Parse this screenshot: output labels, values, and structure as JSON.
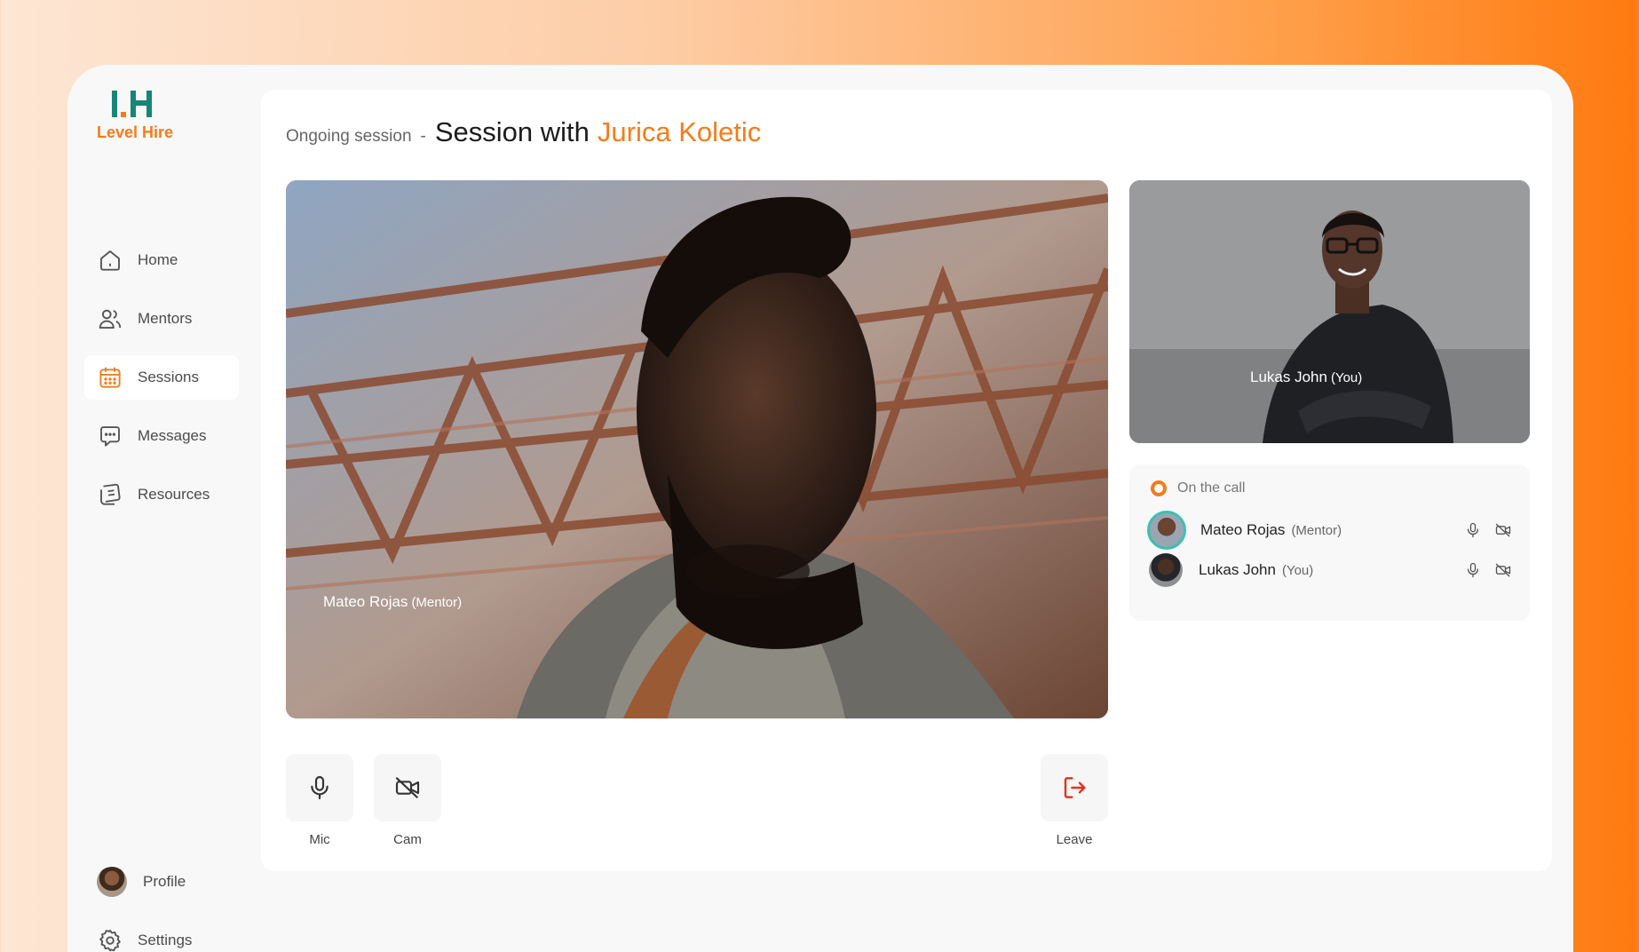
{
  "brand": {
    "name": "Level Hire",
    "accent": "#f47c1b",
    "mark_color": "#178676"
  },
  "sidebar": {
    "items": [
      {
        "label": "Home",
        "icon": "home-icon"
      },
      {
        "label": "Mentors",
        "icon": "users-icon"
      },
      {
        "label": "Sessions",
        "icon": "calendar-icon",
        "active": true
      },
      {
        "label": "Messages",
        "icon": "chat-icon"
      },
      {
        "label": "Resources",
        "icon": "book-icon"
      }
    ],
    "profile_label": "Profile",
    "settings_label": "Settings"
  },
  "header": {
    "prefix": "Ongoing session",
    "separator": "-",
    "title": "Session with",
    "partner_name": "Jurica Koletic"
  },
  "videos": {
    "main": {
      "name": "Mateo Rojas",
      "role": "(Mentor)"
    },
    "self": {
      "name": "Lukas John",
      "role": "(You)"
    }
  },
  "call": {
    "heading": "On the call",
    "participants": [
      {
        "name": "Mateo Rojas",
        "role": "(Mentor)"
      },
      {
        "name": "Lukas John",
        "role": "(You)"
      }
    ]
  },
  "controls": {
    "mic_label": "Mic",
    "cam_label": "Cam",
    "leave_label": "Leave"
  }
}
